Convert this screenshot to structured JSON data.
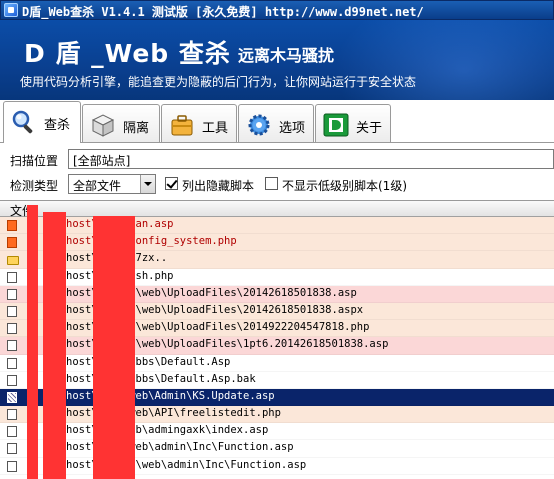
{
  "window": {
    "title": "D盾_Web查杀 V1.4.1 测试版 [永久免费] http://www.d99net.net/"
  },
  "banner": {
    "brand": "D 盾 _Web 查杀",
    "tagline": "远离木马骚扰",
    "subtitle": "使用代码分析引擎，能追查更为隐蔽的后门行为，让你网站运行于安全状态"
  },
  "tabs": [
    {
      "label": "查杀",
      "icon": "magnifier-icon",
      "active": true
    },
    {
      "label": "隔离",
      "icon": "box-icon",
      "active": false
    },
    {
      "label": "工具",
      "icon": "toolbox-icon",
      "active": false
    },
    {
      "label": "选项",
      "icon": "gear-icon",
      "active": false
    },
    {
      "label": "关于",
      "icon": "d-logo-icon",
      "active": false
    }
  ],
  "form": {
    "scan_location_label": "扫描位置",
    "scan_location_value": "[全部站点]",
    "detect_type_label": "检测类型",
    "detect_type_value": "全部文件",
    "show_hidden_label": "列出隐藏脚本",
    "show_hidden_checked": true,
    "hide_low_label": "不显示低级别脚本(1级)",
    "hide_low_checked": false
  },
  "list": {
    "header": "文件",
    "rows": [
      {
        "path": "host\\     web\\ban.asp",
        "color": "#b00000",
        "bg": "#fbe7d9",
        "icon": "orange"
      },
      {
        "path": "host\\     web\\config_system.php",
        "color": "#b00000",
        "bg": "#fbe7d9",
        "icon": "orange"
      },
      {
        "path": "host\\     web\\x7zx..",
        "color": "#000000",
        "bg": "#fbe7d9",
        "icon": "folder"
      },
      {
        "path": "host\\     web\\ysh.php",
        "color": "#000000",
        "bg": "#ffffff",
        "icon": "file"
      },
      {
        "path": "host\\   e1011\\web\\UploadFiles\\20142618501838.asp",
        "color": "#000000",
        "bg": "#fbd7d7",
        "icon": "file"
      },
      {
        "path": "host\\   e1011\\web\\UploadFiles\\20142618501838.aspx",
        "color": "#000000",
        "bg": "#fbe7d9",
        "icon": "file"
      },
      {
        "path": "host\\   e1011\\web\\UploadFiles\\2014922204547818.php",
        "color": "#000000",
        "bg": "#fbe7d9",
        "icon": "file"
      },
      {
        "path": "host\\   e1011\\web\\UploadFiles\\1pt6.20142618501838.asp",
        "color": "#000000",
        "bg": "#fbd7d7",
        "icon": "file"
      },
      {
        "path": "host\\     \\web\\bbs\\Default.Asp",
        "color": "#000000",
        "bg": "#ffffff",
        "icon": "file"
      },
      {
        "path": "host\\     \\web\\bbs\\Default.Asp.bak",
        "color": "#000000",
        "bg": "#ffffff",
        "icon": "file"
      },
      {
        "path": "host\\   ao2\\web\\Admin\\KS.Update.asp",
        "color": "#ffffff",
        "bg": "#0a246a",
        "icon": "sel"
      },
      {
        "path": "host\\   ao2\\web\\API\\freelistedit.php",
        "color": "#000000",
        "bg": "#fbe7d9",
        "icon": "file"
      },
      {
        "path": "host\\   36\\web\\admingaxk\\index.asp",
        "color": "#000000",
        "bg": "#ffffff",
        "icon": "file"
      },
      {
        "path": "host\\   329\\web\\admin\\Inc\\Function.asp",
        "color": "#000000",
        "bg": "#ffffff",
        "icon": "file"
      },
      {
        "path": "host\\   n1108\\web\\admin\\Inc\\Function.asp",
        "color": "#000000",
        "bg": "#ffffff",
        "icon": "file"
      }
    ]
  }
}
